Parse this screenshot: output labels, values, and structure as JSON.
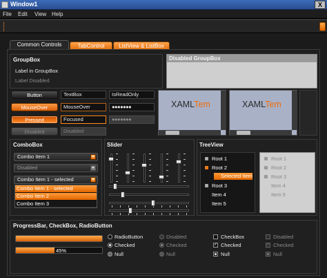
{
  "window": {
    "title": "Window1",
    "close_glyph": "X"
  },
  "menu": [
    "File",
    "Edit",
    "View",
    "Help"
  ],
  "tabs": [
    "Common Controls",
    "TabControl",
    "ListView & ListBox"
  ],
  "groupbox": {
    "title": "GroupBox",
    "label": "Label in GroupBox",
    "label_disabled": "Label Disabled",
    "disabled_title": "Disabled GroupBox"
  },
  "buttons": {
    "normal": "Button",
    "mouseover": "MouseOver",
    "pressed": "Pressed",
    "disabled": "Disabled"
  },
  "textboxes": {
    "normal": "TextBox",
    "mouseover": "MouseOver",
    "focused": "Focused",
    "disabled": "Disabled",
    "readonly": "IsReadOnly",
    "password": "●●●●●●●",
    "password_disabled": "●●●●●●●"
  },
  "xaml_text": {
    "prefix": "XAML",
    "suffix": "Tem"
  },
  "combobox": {
    "title": "ComboBox",
    "item1": "Combo Item 1",
    "disabled": "Disabled",
    "item1_selected": "Combo Item 1 - selected",
    "list": [
      "Combo Item 1 - selected",
      "Combo Item 2",
      "Combo Item 3"
    ],
    "arrow_glyph": "▼"
  },
  "slider": {
    "title": "Slider",
    "vertical_levels": [
      0.85,
      0.3,
      0.6,
      0.15,
      0.75
    ],
    "horizontal_levels": [
      0.05,
      0.15,
      0.55,
      0.25
    ]
  },
  "treeview": {
    "title": "TreeView",
    "items": [
      "Root 1",
      "Root 2",
      "Selected Item",
      "Root 3",
      "Item 4",
      "Item 5"
    ],
    "disabled_items": [
      "Root 1",
      "Root 2",
      "Root 3",
      "Item 4",
      "Item 5"
    ]
  },
  "progress": {
    "title": "ProgressBar, CheckBox, RadioButton",
    "bar1": 1.0,
    "bar2": 0.45,
    "bar2_label": "45%"
  },
  "radios": [
    "RadioButton",
    "Checked",
    "Null"
  ],
  "radios_disabled": [
    "Disabled",
    "Checked",
    "Null"
  ],
  "checks": [
    "CheckBox",
    "Checked",
    "Null"
  ],
  "checks_disabled": [
    "Disabled",
    "Checked",
    "Null"
  ],
  "colors": {
    "accent": "#f07a16",
    "background": "#1e1e1e",
    "titlebar": "#2d5aa6"
  },
  "icons": {
    "check": "✓"
  }
}
